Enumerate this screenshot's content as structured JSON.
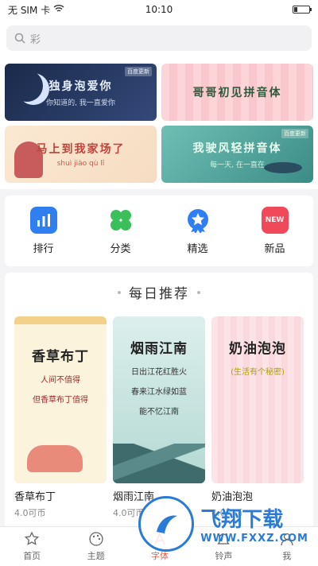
{
  "status": {
    "carrier": "无 SIM 卡",
    "time": "10:10",
    "battery_level": 0.2
  },
  "search": {
    "placeholder": "彩"
  },
  "banners": [
    {
      "title": "独身泡爱你",
      "sub": "你知道的, 我一直爱你",
      "tag": "百度更新"
    },
    {
      "title": "哥哥初见拼音体",
      "sub": "",
      "tag": ""
    },
    {
      "title": "马上到我家场了",
      "sub": "shuì jiào qù lǐ",
      "tag": ""
    },
    {
      "title": "我驶风轻拼音体",
      "sub": "每一天, 在一直在",
      "tag": "百度更新"
    }
  ],
  "categories": [
    {
      "label": "排行",
      "icon": "bar-chart-icon",
      "color": "#2f7ff0"
    },
    {
      "label": "分类",
      "icon": "clover-icon",
      "color": "#3bbf5a"
    },
    {
      "label": "精选",
      "icon": "star-badge-icon",
      "color": "#2f7ff0"
    },
    {
      "label": "新品",
      "icon": "new-badge-icon",
      "color": "#f0495a",
      "badge": "NEW"
    }
  ],
  "daily": {
    "title": "每日推荐",
    "cards": [
      {
        "art_title": "香草布丁",
        "lines": [
          "人间不值得",
          "但香草布丁值得"
        ],
        "name": "香草布丁",
        "price": "4.0可币"
      },
      {
        "art_title": "烟雨江南",
        "lines": [
          "日出江花红胜火",
          "春来江水绿如蓝",
          "能不忆江南"
        ],
        "name": "烟雨江南",
        "price": "4.0可币"
      },
      {
        "art_title": "奶油泡泡",
        "lines": [
          "(生活有个秘密)"
        ],
        "name": "奶油泡泡",
        "price": "4.0可币"
      }
    ]
  },
  "nav": [
    {
      "label": "首页",
      "icon": "star-outline-icon",
      "active": false
    },
    {
      "label": "主题",
      "icon": "palette-icon",
      "active": false
    },
    {
      "label": "字体",
      "icon": "font-icon",
      "active": true
    },
    {
      "label": "铃声",
      "icon": "bell-icon",
      "active": false
    },
    {
      "label": "我",
      "icon": "user-icon",
      "active": false
    }
  ],
  "watermark": {
    "title": "飞翔下载",
    "url": "WWW.FXXZ.COM"
  },
  "colors": {
    "accent": "#f05a4a",
    "brand_blue": "#2a7bd8"
  }
}
